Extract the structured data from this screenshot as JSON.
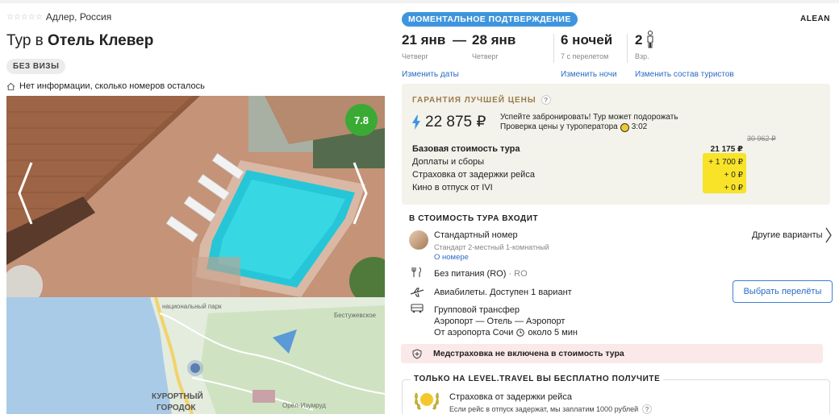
{
  "hotel": {
    "stars_glyph": "☆☆☆☆☆",
    "location": "Адлер, Россия",
    "title_prefix": "Тур в",
    "title_name": "Отель Клевер",
    "visa_badge": "БЕЗ ВИЗЫ",
    "rooms_info": "Нет информации, сколько номеров осталось",
    "rating": "7.8"
  },
  "map": {
    "labels": {
      "park": "национальный парк",
      "bestuzh": "Бестужевское",
      "kurort1": "КУРОРТНЫЙ",
      "kurort2": "ГОРОДОК",
      "orel": "Орёл-Изумруд"
    }
  },
  "header": {
    "instant_badge": "МОМЕНТАЛЬНОЕ ПОДТВЕРЖДЕНИЕ",
    "brand": "ALEAN"
  },
  "trip": {
    "date_from": "21 янв",
    "dash": "—",
    "date_to": "28 янв",
    "day_from": "Четверг",
    "day_to": "Четверг",
    "nights": "6 ночей",
    "nights_sub": "7 с перелетом",
    "tourists": "2",
    "tourists_sub": "Взр.",
    "change_dates": "Изменить даты",
    "change_nights": "Изменить ночи",
    "change_tourists": "Изменить состав туристов"
  },
  "price": {
    "guarantee": "ГАРАНТИЯ ЛУЧШЕЙ ЦЕНЫ",
    "qmark": "?",
    "total": "22 875 ₽",
    "note_line1": "Успейте забронировать! Тур может подорожать",
    "note_line2": "Проверка цены у туроператора",
    "timer": "3:02",
    "old_price": "30 962 ₽",
    "rows": [
      {
        "label": "Базовая стоимость тура",
        "value": "21 175 ₽"
      },
      {
        "label": "Доплаты и сборы",
        "value": "+ 1 700 ₽"
      },
      {
        "label": "Страховка от задержки рейса",
        "value": "+ 0 ₽"
      },
      {
        "label": "Кино в отпуск от IVI",
        "value": "+ 0 ₽"
      }
    ]
  },
  "included": {
    "header": "В СТОИМОСТЬ ТУРА ВХОДИТ",
    "room_title": "Стандартный номер",
    "room_sub": "Стандарт 2-местный 1-комнатный",
    "room_link": "О номере",
    "other_variants": "Другие варианты",
    "meal": "Без питания (RO)",
    "meal_code": "· RO",
    "flights": "Авиабилеты. Доступен 1 вариант",
    "flights_btn": "Выбрать перелёты",
    "transfer_title": "Групповой трансфер",
    "transfer_route": "Аэропорт — Отель — Аэропорт",
    "transfer_time_prefix": "От аэропорта Сочи",
    "transfer_time": "около 5 мин"
  },
  "insurance_notice": "Медстраховка не включена в стоимость тура",
  "free": {
    "header": "ТОЛЬКО НА LEVEL.TRAVEL ВЫ БЕСПЛАТНО ПОЛУЧИТЕ",
    "title": "Страховка от задержки рейса",
    "sub": "Если рейс в отпуск задержат, мы заплатим 1000 рублей",
    "qmark": "?"
  },
  "colors": {
    "accent_blue": "#3e95de",
    "rating_green": "#3aaa35",
    "highlight_yellow": "#f8e329",
    "gold": "#9a7c4a",
    "notice_pink": "#fbe9e9"
  }
}
